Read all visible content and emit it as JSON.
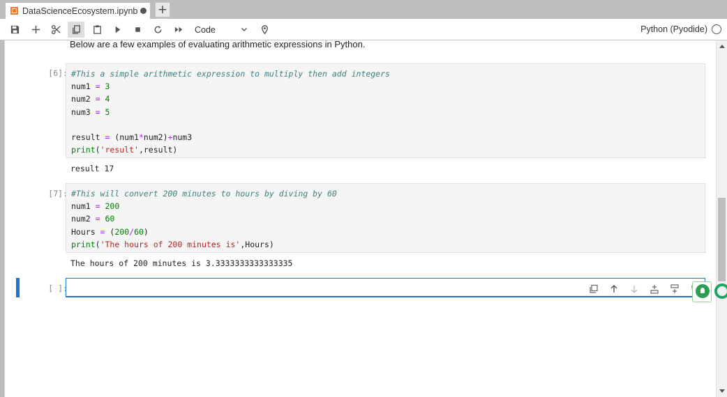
{
  "tab": {
    "title": "DataScienceEcosystem.ipynb",
    "new_tab_symbol": "+"
  },
  "toolbar": {
    "cell_type": "Code",
    "kernel": "Python (Pyodide)",
    "icons": [
      "save-icon",
      "add-cell-icon",
      "cut-icon",
      "copy-icon",
      "paste-icon",
      "run-icon",
      "stop-icon",
      "restart-icon",
      "run-all-icon",
      "chevron-down-icon",
      "debugger-icon",
      "kernel-status-icon"
    ]
  },
  "notebook": {
    "markdown_text": "Below are a few examples of evaluating arithmetic expressions in Python.",
    "cells": [
      {
        "prompt": "[6]:",
        "lines": [
          [
            [
              "cm-comment",
              "#This a simple arithmetic expression to multiply then add integers"
            ]
          ],
          [
            [
              "",
              "num1 "
            ],
            [
              "cm-op",
              "="
            ],
            [
              "",
              " "
            ],
            [
              "cm-num",
              "3"
            ]
          ],
          [
            [
              "",
              "num2 "
            ],
            [
              "cm-op",
              "="
            ],
            [
              "",
              " "
            ],
            [
              "cm-num",
              "4"
            ]
          ],
          [
            [
              "",
              "num3 "
            ],
            [
              "cm-op",
              "="
            ],
            [
              "",
              " "
            ],
            [
              "cm-num",
              "5"
            ]
          ],
          [
            [
              "",
              ""
            ]
          ],
          [
            [
              "",
              "result "
            ],
            [
              "cm-op",
              "="
            ],
            [
              "",
              " (num1"
            ],
            [
              "cm-op",
              "*"
            ],
            [
              "",
              "num2)"
            ],
            [
              "cm-op",
              "+"
            ],
            [
              "",
              "num3"
            ]
          ],
          [
            [
              "cm-builtin",
              "print"
            ],
            [
              "",
              "("
            ],
            [
              "cm-str",
              "'result'"
            ],
            [
              "",
              ",result)"
            ]
          ]
        ],
        "output": "result 17"
      },
      {
        "prompt": "[7]:",
        "lines": [
          [
            [
              "cm-comment",
              "#This will convert 200 minutes to hours by diving by 60"
            ]
          ],
          [
            [
              "",
              "num1 "
            ],
            [
              "cm-op",
              "="
            ],
            [
              "",
              " "
            ],
            [
              "cm-num",
              "200"
            ]
          ],
          [
            [
              "",
              "num2 "
            ],
            [
              "cm-op",
              "="
            ],
            [
              "",
              " "
            ],
            [
              "cm-num",
              "60"
            ]
          ],
          [
            [
              "",
              "Hours "
            ],
            [
              "cm-op",
              "="
            ],
            [
              "",
              " ("
            ],
            [
              "cm-num",
              "200"
            ],
            [
              "cm-op",
              "/"
            ],
            [
              "cm-num",
              "60"
            ],
            [
              "",
              ")"
            ]
          ],
          [
            [
              "cm-builtin",
              "print"
            ],
            [
              "",
              "("
            ],
            [
              "cm-str",
              "'The hours of 200 minutes is'"
            ],
            [
              "",
              ",Hours)"
            ]
          ]
        ],
        "output": "The hours of 200 minutes is 3.3333333333333335"
      }
    ],
    "empty_cell_prompt": "[ ]:"
  },
  "cell_toolbar": {
    "icons": [
      "duplicate-cell-icon",
      "move-up-icon",
      "move-down-icon",
      "insert-above-icon",
      "insert-below-icon",
      "delete-cell-icon"
    ]
  },
  "colors": {
    "accent": "#1976d2",
    "jupyter_orange": "#f37726",
    "extension_green": "#1fa463"
  }
}
